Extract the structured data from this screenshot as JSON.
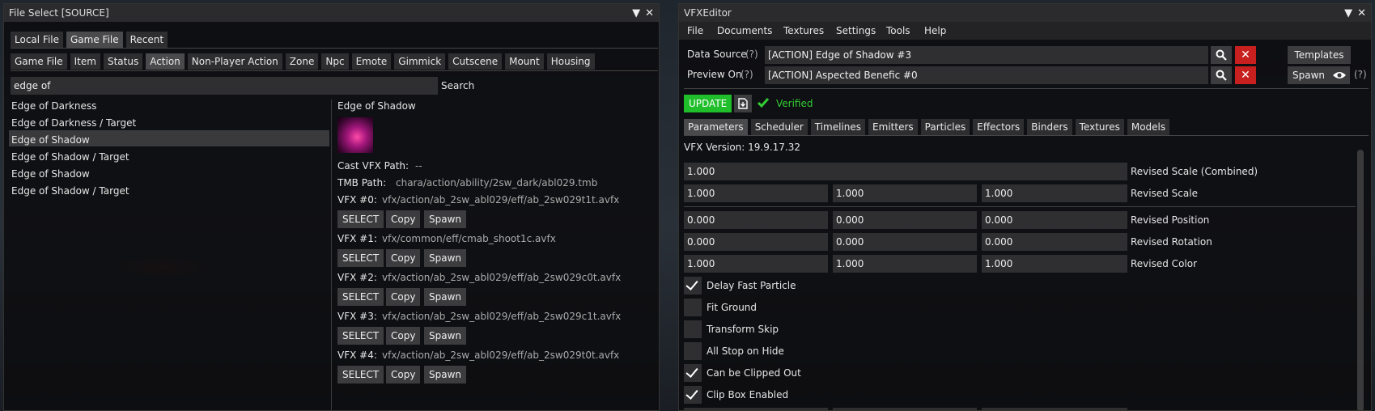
{
  "left": {
    "title": "File Select [SOURCE]",
    "source_tabs": [
      "Local File",
      "Game File",
      "Recent"
    ],
    "category_tabs": [
      "Game File",
      "Item",
      "Status",
      "Action",
      "Non-Player Action",
      "Zone",
      "Npc",
      "Emote",
      "Gimmick",
      "Cutscene",
      "Mount",
      "Housing"
    ],
    "search": {
      "value": "edge of",
      "button": "Search"
    },
    "results": [
      "Edge of Darkness",
      "Edge of Darkness / Target",
      "Edge of Shadow",
      "Edge of Shadow / Target",
      "Edge of Shadow",
      "Edge of Shadow / Target"
    ],
    "detail": {
      "name": "Edge of Shadow",
      "cast_label": "Cast VFX Path:",
      "cast_value": "--",
      "tmb_label": "TMB Path:",
      "tmb_value": "chara/action/ability/2sw_dark/abl029.tmb",
      "vfx": [
        {
          "label": "VFX #0:",
          "path": "vfx/action/ab_2sw_abl029/eff/ab_2sw029t1t.avfx"
        },
        {
          "label": "VFX #1:",
          "path": "vfx/common/eff/cmab_shoot1c.avfx"
        },
        {
          "label": "VFX #2:",
          "path": "vfx/action/ab_2sw_abl029/eff/ab_2sw029c0t.avfx"
        },
        {
          "label": "VFX #3:",
          "path": "vfx/action/ab_2sw_abl029/eff/ab_2sw029c1t.avfx"
        },
        {
          "label": "VFX #4:",
          "path": "vfx/action/ab_2sw_abl029/eff/ab_2sw029t0t.avfx"
        }
      ],
      "select_label": "SELECT",
      "copy_label": "Copy",
      "spawn_label": "Spawn"
    }
  },
  "right": {
    "title": "VFXEditor",
    "menu": [
      "File",
      "Documents",
      "Textures",
      "Settings",
      "Tools",
      "Help"
    ],
    "data_source_label": "Data Source",
    "preview_on_label": "Preview On",
    "help_mark": "(?)",
    "data_source_value": "[ACTION] Edge of Shadow #3",
    "preview_on_value": "[ACTION] Aspected Benefic #0",
    "templates_label": "Templates",
    "spawn_label": "Spawn",
    "update_label": "UPDATE",
    "verified_label": "Verified",
    "tabs": [
      "Parameters",
      "Scheduler",
      "Timelines",
      "Emitters",
      "Particles",
      "Effectors",
      "Binders",
      "Textures",
      "Models"
    ],
    "version": "VFX Version: 19.9.17.32",
    "revised_scale_combined": {
      "label": "Revised Scale (Combined)",
      "value": "1.000"
    },
    "rows": [
      {
        "label": "Revised Scale",
        "values": [
          "1.000",
          "1.000",
          "1.000"
        ]
      },
      {
        "label": "Revised Position",
        "values": [
          "0.000",
          "0.000",
          "0.000"
        ]
      },
      {
        "label": "Revised Rotation",
        "values": [
          "0.000",
          "0.000",
          "0.000"
        ]
      },
      {
        "label": "Revised Color",
        "values": [
          "1.000",
          "1.000",
          "1.000"
        ]
      }
    ],
    "checkboxes": [
      {
        "label": "Delay Fast Particle",
        "checked": true
      },
      {
        "label": "Fit Ground",
        "checked": false
      },
      {
        "label": "Transform Skip",
        "checked": false
      },
      {
        "label": "All Stop on Hide",
        "checked": false
      },
      {
        "label": "Can be Clipped Out",
        "checked": true
      },
      {
        "label": "Clip Box Enabled",
        "checked": true
      }
    ],
    "colors": {
      "update": "#1fbe2a",
      "verified": "#33cc33",
      "remove": "#c8201e"
    }
  }
}
